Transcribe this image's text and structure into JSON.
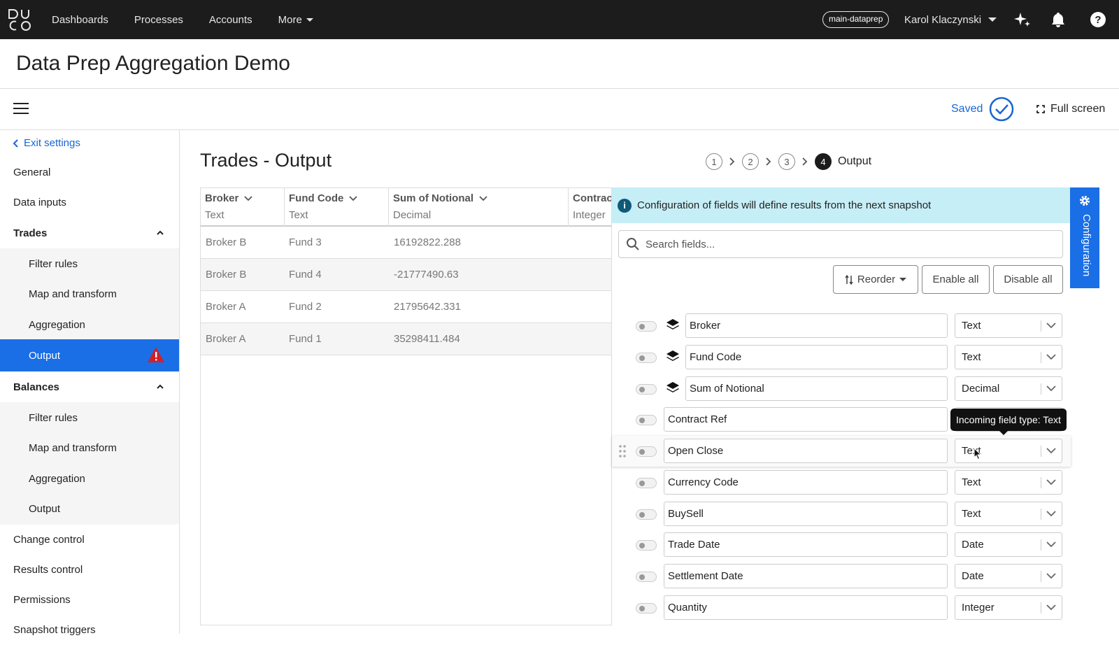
{
  "topnav": {
    "links": [
      "Dashboards",
      "Processes",
      "Accounts",
      "More"
    ],
    "env_badge": "main-dataprep",
    "user_name": "Karol Klaczynski",
    "icons": [
      "sparkle-icon",
      "bell-icon",
      "help-icon"
    ]
  },
  "page": {
    "title": "Data Prep Aggregation Demo"
  },
  "toolbar": {
    "saved_label": "Saved",
    "fullscreen_label": "Full screen"
  },
  "sidebar": {
    "exit_label": "Exit settings",
    "items": [
      {
        "label": "General"
      },
      {
        "label": "Data inputs"
      },
      {
        "label": "Trades"
      },
      {
        "label": "Filter rules"
      },
      {
        "label": "Map and transform"
      },
      {
        "label": "Aggregation"
      },
      {
        "label": "Output"
      },
      {
        "label": "Balances"
      },
      {
        "label": "Filter rules"
      },
      {
        "label": "Map and transform"
      },
      {
        "label": "Aggregation"
      },
      {
        "label": "Output"
      },
      {
        "label": "Change control"
      },
      {
        "label": "Results control"
      },
      {
        "label": "Permissions"
      },
      {
        "label": "Snapshot triggers"
      }
    ]
  },
  "main": {
    "title": "Trades - Output",
    "stepper": {
      "steps": [
        "1",
        "2",
        "3",
        "4"
      ],
      "current_label": "Output"
    }
  },
  "grid": {
    "columns": [
      {
        "name": "Broker",
        "type": "Text"
      },
      {
        "name": "Fund Code",
        "type": "Text"
      },
      {
        "name": "Sum of Notional",
        "type": "Decimal"
      },
      {
        "name": "Contrac",
        "type": "Integer"
      }
    ],
    "rows": [
      [
        "Broker B",
        "Fund 3",
        "16192822.288"
      ],
      [
        "Broker B",
        "Fund 4",
        "-21777490.63"
      ],
      [
        "Broker A",
        "Fund 2",
        "21795642.331"
      ],
      [
        "Broker A",
        "Fund 1",
        "35298411.484"
      ]
    ]
  },
  "config": {
    "info": "Configuration of fields will define results from the next snapshot",
    "search_placeholder": "Search fields...",
    "buttons": {
      "reorder": "Reorder",
      "enable_all": "Enable all",
      "disable_all": "Disable all"
    },
    "fields": [
      {
        "name": "Broker",
        "type": "Text"
      },
      {
        "name": "Fund Code",
        "type": "Text"
      },
      {
        "name": "Sum of Notional",
        "type": "Decimal"
      },
      {
        "name": "Contract Ref",
        "type": ""
      },
      {
        "name": "Open Close",
        "type": "Text"
      },
      {
        "name": "Currency Code",
        "type": "Text"
      },
      {
        "name": "BuySell",
        "type": "Text"
      },
      {
        "name": "Trade Date",
        "type": "Date"
      },
      {
        "name": "Settlement Date",
        "type": "Date"
      },
      {
        "name": "Quantity",
        "type": "Integer"
      }
    ],
    "tooltip": "Incoming field type: Text",
    "tab_label": "Configuration"
  },
  "colors": {
    "accent": "#1a6ee6",
    "nav_bg": "#1c1c1c",
    "info_bg": "#c6eef6",
    "warning": "#d0212a"
  }
}
